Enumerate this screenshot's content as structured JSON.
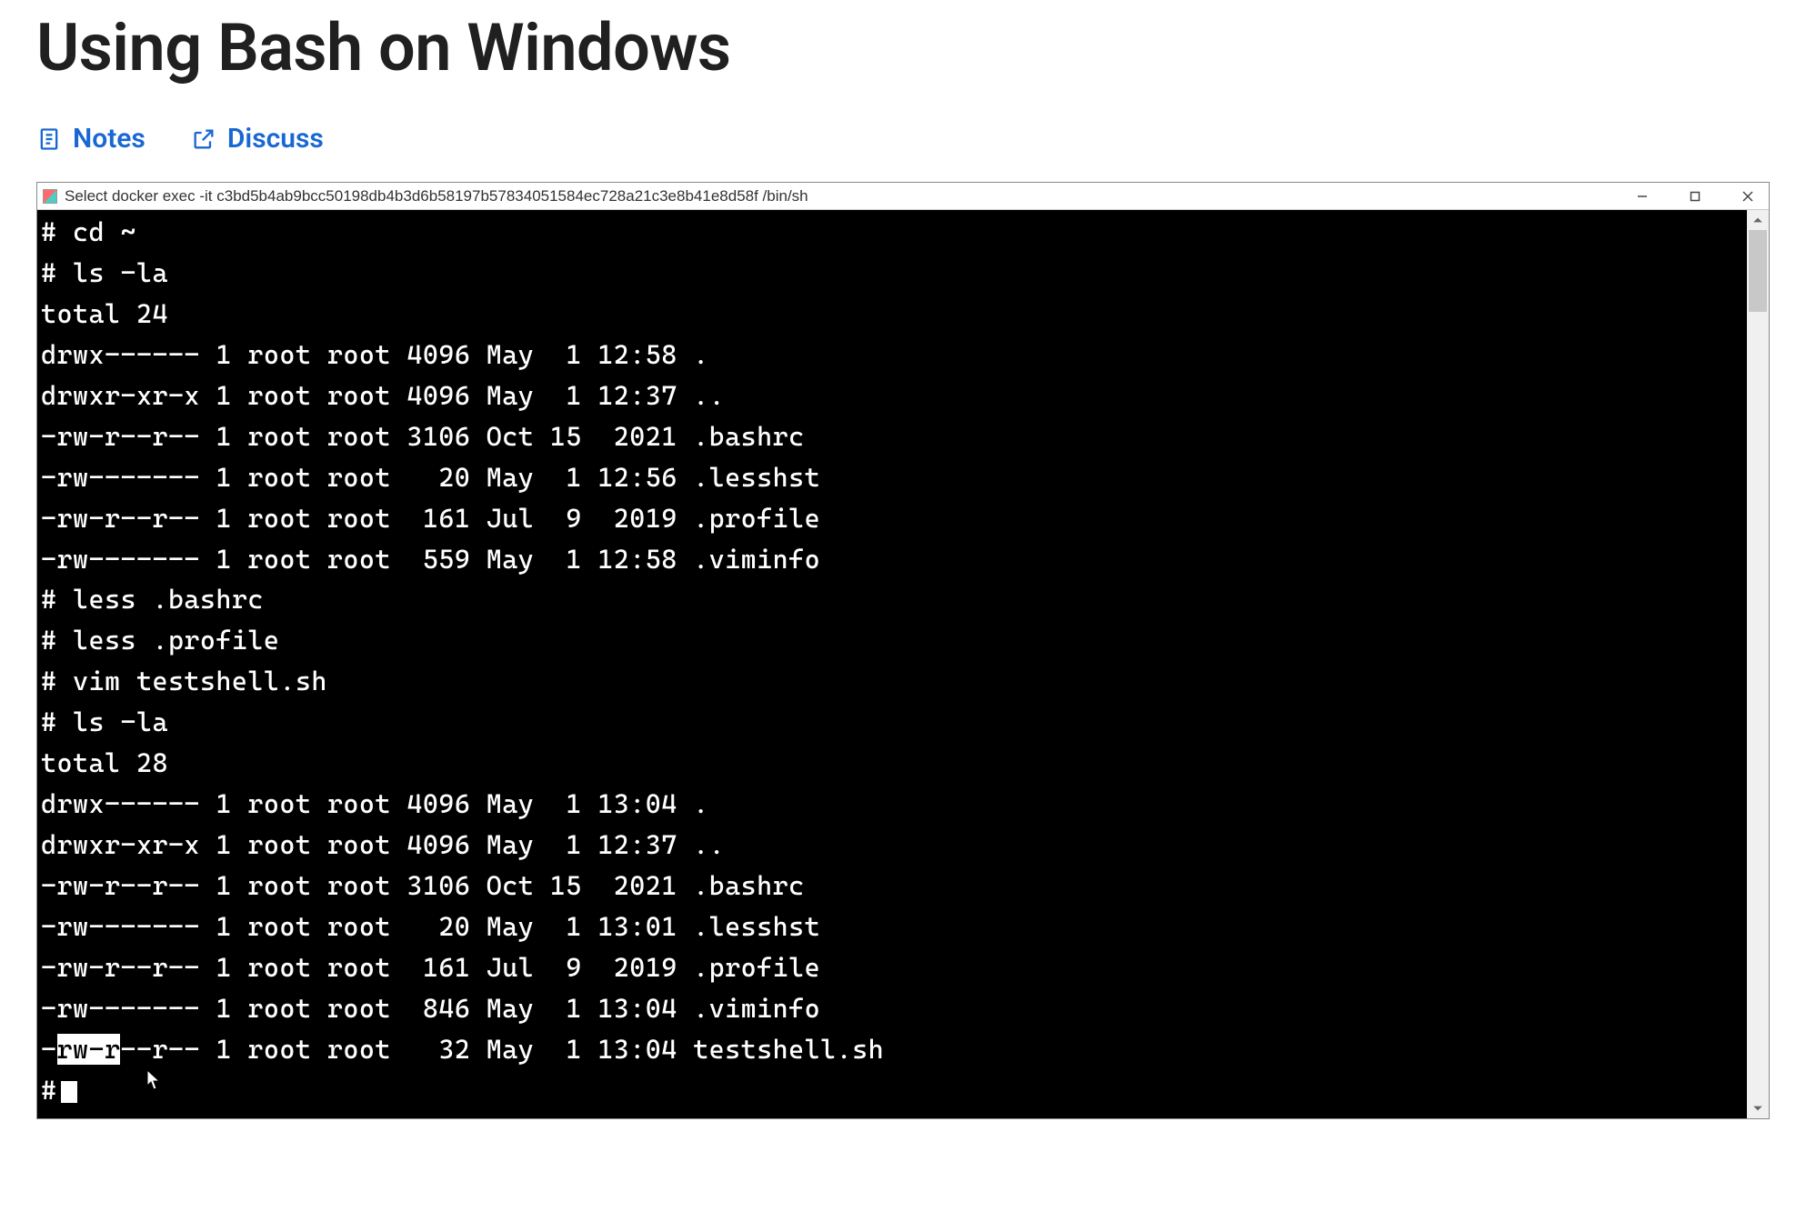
{
  "page": {
    "title": "Using Bash on Windows"
  },
  "actions": {
    "notes": "Notes",
    "discuss": "Discuss"
  },
  "terminal": {
    "titlebar": "Select docker  exec -it c3bd5b4ab9bcc50198db4b3d6b58197b57834051584ec728a21c3e8b41e8d58f /bin/sh",
    "lines": [
      "# cd ~",
      "# ls -la",
      "total 24",
      "drwx------ 1 root root 4096 May  1 12:58 .",
      "drwxr-xr-x 1 root root 4096 May  1 12:37 ..",
      "-rw-r--r-- 1 root root 3106 Oct 15  2021 .bashrc",
      "-rw------- 1 root root   20 May  1 12:56 .lesshst",
      "-rw-r--r-- 1 root root  161 Jul  9  2019 .profile",
      "-rw------- 1 root root  559 May  1 12:58 .viminfo",
      "# less .bashrc",
      "# less .profile",
      "# vim testshell.sh",
      "# ls -la",
      "total 28",
      "drwx------ 1 root root 4096 May  1 13:04 .",
      "drwxr-xr-x 1 root root 4096 May  1 12:37 ..",
      "-rw-r--r-- 1 root root 3106 Oct 15  2021 .bashrc",
      "-rw------- 1 root root   20 May  1 13:01 .lesshst",
      "-rw-r--r-- 1 root root  161 Jul  9  2019 .profile",
      "-rw------- 1 root root  846 May  1 13:04 .viminfo"
    ],
    "highlight_line": {
      "pre": "-",
      "sel": "rw-r",
      "post": "--r-- 1 root root   32 May  1 13:04 testshell.sh"
    },
    "prompt": "#"
  }
}
